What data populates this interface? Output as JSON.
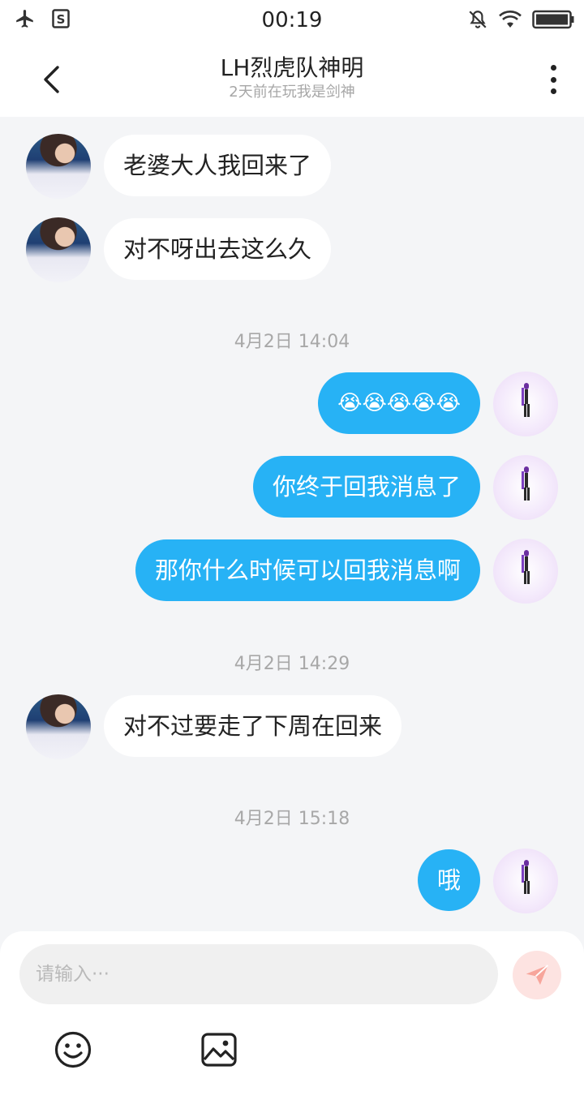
{
  "status_bar": {
    "time": "00:19",
    "left_icons": [
      "airplane-icon",
      "sim-s-icon"
    ],
    "right_icons": [
      "mute-bell-icon",
      "wifi-icon",
      "battery-icon"
    ]
  },
  "header": {
    "title": "LH烈虎队神明",
    "subtitle": "2天前在玩我是剑神",
    "back_icon": "chevron-left-icon",
    "more_icon": "more-vertical-icon"
  },
  "messages": [
    {
      "side": "in",
      "text": "老婆大人我回来了"
    },
    {
      "side": "in",
      "text": "对不呀出去这么久"
    },
    {
      "type": "timestamp",
      "text": "4月2日 14:04"
    },
    {
      "side": "out",
      "text": "😭😭😭😭😭"
    },
    {
      "side": "out",
      "text": "你终于回我消息了"
    },
    {
      "side": "out",
      "text": "那你什么时候可以回我消息啊"
    },
    {
      "type": "timestamp",
      "text": "4月2日 14:29"
    },
    {
      "side": "in",
      "text": "对不过要走了下周在回来"
    },
    {
      "type": "timestamp",
      "text": "4月2日 15:18"
    },
    {
      "side": "out",
      "text": "哦"
    }
  ],
  "composer": {
    "placeholder": "请输入···",
    "send_icon": "paper-plane-icon",
    "tools": [
      "smiley-icon",
      "image-icon"
    ]
  },
  "colors": {
    "accent_blue": "#27b2f5",
    "background": "#f4f5f7",
    "send_bg": "#fde3e1",
    "send_icon": "#f7a59b"
  }
}
